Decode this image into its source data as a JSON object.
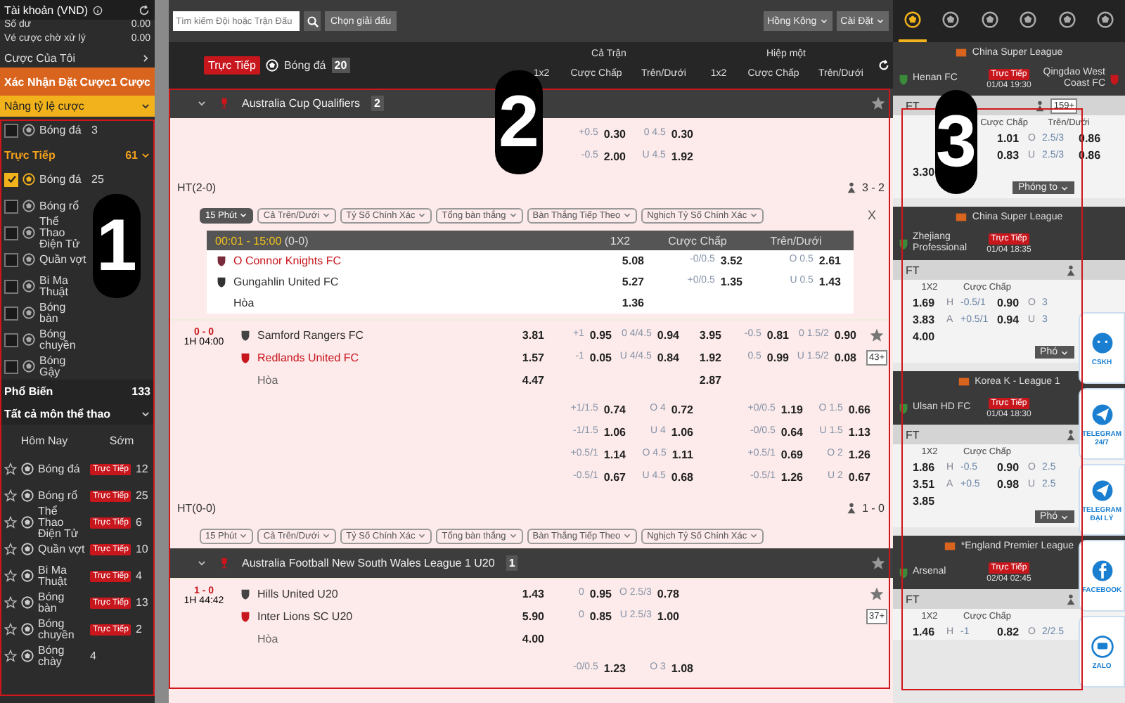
{
  "annotations": [
    "1",
    "2",
    "3"
  ],
  "sidebar": {
    "account": {
      "title": "Tài khoản (VND)",
      "rows": [
        {
          "label": "Số dư",
          "value": "0.00"
        },
        {
          "label": "Vé cược chờ xử lý",
          "value": "0.00"
        }
      ]
    },
    "my_bets": "Cược Của Tôi",
    "confirm": {
      "label": "Xác Nhận Đặt Cược",
      "count": "1 Cược"
    },
    "boost": {
      "label": "Nâng tỷ lệ cược",
      "items": [
        {
          "label": "Bóng đá",
          "count": "3",
          "checked": false
        }
      ]
    },
    "live": {
      "label": "Trực Tiếp",
      "count": "61",
      "items": [
        {
          "label": "Bóng đá",
          "count": "25",
          "checked": true
        },
        {
          "label": "Bóng rổ",
          "checked": false
        },
        {
          "label": "Thể Thao Điện Tử",
          "checked": false
        },
        {
          "label": "Quần vợt",
          "checked": false
        },
        {
          "label": "Bi Ma Thuật",
          "checked": false
        },
        {
          "label": "Bóng bàn",
          "checked": false
        },
        {
          "label": "Bóng chuyền",
          "checked": false
        },
        {
          "label": "Bóng Gậy",
          "checked": false
        }
      ]
    },
    "popular": {
      "label": "Phổ Biến",
      "count": "133"
    },
    "all_sports": {
      "label": "Tất cả môn thể thao",
      "columns": [
        "Hôm Nay",
        "Sớm"
      ],
      "items": [
        {
          "label": "Bóng đá",
          "badge": "Trực Tiếp",
          "count": "12"
        },
        {
          "label": "Bóng rổ",
          "badge": "Trực Tiếp",
          "count": "25"
        },
        {
          "label": "Thể Thao Điện Tử",
          "badge": "Trực Tiếp",
          "count": "6"
        },
        {
          "label": "Quần vợt",
          "badge": "Trực Tiếp",
          "count": "10"
        },
        {
          "label": "Bi Ma Thuật",
          "badge": "Trực Tiếp",
          "count": "4"
        },
        {
          "label": "Bóng bàn",
          "badge": "Trực Tiếp",
          "count": "13"
        },
        {
          "label": "Bóng chuyền",
          "badge": "Trực Tiếp",
          "count": "2"
        },
        {
          "label": "Bóng chày",
          "count": "4"
        }
      ]
    }
  },
  "main": {
    "search": {
      "placeholder": "Tìm kiếm Đội hoặc Trận Đấu"
    },
    "league_button": "Chọn giải đấu",
    "dropdowns": [
      "Hồng Kông",
      "Cài Đặt"
    ],
    "live_bar": {
      "badge": "Trực Tiếp",
      "sport": "Bóng đá",
      "count": "20"
    },
    "column_groups": [
      "Cả Trận",
      "Hiệp một"
    ],
    "columns": [
      "1x2",
      "Cược Chấp",
      "Trên/Dưới",
      "1x2",
      "Cược Chấp",
      "Trên/Dưới"
    ],
    "sections": [
      {
        "kind": "league",
        "name": "Australia Cup Qualifiers",
        "count": "2"
      },
      {
        "kind": "lines",
        "rows": [
          [
            null,
            {
              "line": "+0.5",
              "odds": "0.30"
            },
            {
              "line": "0 4.5",
              "odds": "0.30"
            },
            null,
            null,
            null
          ],
          [
            null,
            {
              "line": "-0.5",
              "odds": "2.00"
            },
            {
              "line": "U 4.5",
              "odds": "1.92"
            },
            null,
            null,
            null
          ]
        ]
      },
      {
        "kind": "ht",
        "label": "HT(2-0)",
        "score": "3 - 2"
      },
      {
        "kind": "chips",
        "close": "X",
        "chips": [
          {
            "label": "15 Phút",
            "selected": true
          },
          {
            "label": "Cả Trên/Dưới",
            "selected": false
          },
          {
            "label": "Tỷ Số Chính Xác",
            "selected": false
          },
          {
            "label": "Tổng bàn thắng",
            "selected": false
          },
          {
            "label": "Bàn Thắng Tiếp Theo",
            "selected": false
          },
          {
            "label": "Nghịch Tỷ Số Chính Xác",
            "selected": false
          }
        ]
      },
      {
        "kind": "detail",
        "period": "00:01 - 15:00",
        "score": "(0-0)",
        "columns": [
          "1X2",
          "Cược Chấp",
          "Trên/Dưới"
        ],
        "rows": [
          {
            "team": "O Connor Knights FC",
            "highlighted": true,
            "x12": "5.08",
            "hcap": {
              "line": "-0/0.5",
              "odds": "3.52"
            },
            "ou": {
              "line": "O 0.5",
              "odds": "2.61"
            }
          },
          {
            "team": "Gungahlin United FC",
            "highlighted": false,
            "x12": "5.27",
            "hcap": {
              "line": "+0/0.5",
              "odds": "1.35"
            },
            "ou": {
              "line": "U 0.5",
              "odds": "1.43"
            }
          },
          {
            "team": "Hòa",
            "x12": "1.36"
          }
        ]
      },
      {
        "kind": "match",
        "score": "0 - 0",
        "time": "1H 04:00",
        "teams": [
          {
            "name": "Samford Rangers FC",
            "highlighted": false
          },
          {
            "name": "Redlands United FC",
            "highlighted": true
          }
        ],
        "draw": "Hòa",
        "more": "43+",
        "rows": [
          [
            {
              "odds": "3.81"
            },
            {
              "line": "+1",
              "odds": "0.95"
            },
            {
              "line": "0 4/4.5",
              "odds": "0.94"
            },
            {
              "odds": "3.95"
            },
            {
              "line": "-0.5",
              "odds": "0.81"
            },
            {
              "line": "0 1.5/2",
              "odds": "0.90"
            }
          ],
          [
            {
              "odds": "1.57"
            },
            {
              "line": "-1",
              "odds": "0.05"
            },
            {
              "line": "U 4/4.5",
              "odds": "0.84"
            },
            {
              "odds": "1.92"
            },
            {
              "line": "0.5",
              "odds": "0.99"
            },
            {
              "line": "U 1.5/2",
              "odds": "0.08"
            }
          ],
          [
            {
              "odds": "4.47"
            },
            null,
            null,
            {
              "odds": "2.87"
            },
            null,
            null
          ]
        ]
      },
      {
        "kind": "lines",
        "rows": [
          [
            null,
            {
              "line": "+1/1.5",
              "odds": "0.74"
            },
            {
              "line": "O 4",
              "odds": "0.72"
            },
            null,
            {
              "line": "+0/0.5",
              "odds": "1.19"
            },
            {
              "line": "O 1.5",
              "odds": "0.66"
            }
          ],
          [
            null,
            {
              "line": "-1/1.5",
              "odds": "1.06"
            },
            {
              "line": "U 4",
              "odds": "1.06"
            },
            null,
            {
              "line": "-0/0.5",
              "odds": "0.64"
            },
            {
              "line": "U 1.5",
              "odds": "1.13"
            }
          ],
          [
            null,
            {
              "line": "+0.5/1",
              "odds": "1.14"
            },
            {
              "line": "O 4.5",
              "odds": "1.11"
            },
            null,
            {
              "line": "+0.5/1",
              "odds": "0.69"
            },
            {
              "line": "O 2",
              "odds": "1.26"
            }
          ],
          [
            null,
            {
              "line": "-0.5/1",
              "odds": "0.67"
            },
            {
              "line": "U 4.5",
              "odds": "0.68"
            },
            null,
            {
              "line": "-0.5/1",
              "odds": "1.26"
            },
            {
              "line": "U 2",
              "odds": "0.67"
            }
          ]
        ]
      },
      {
        "kind": "ht",
        "label": "HT(0-0)",
        "score": "1 - 0"
      },
      {
        "kind": "chips",
        "chips": [
          {
            "label": "15 Phút",
            "selected": false
          },
          {
            "label": "Cả Trên/Dưới",
            "selected": false
          },
          {
            "label": "Tỷ Số Chính Xác",
            "selected": false
          },
          {
            "label": "Tổng bàn thắng",
            "selected": false
          },
          {
            "label": "Bàn Thắng Tiếp Theo",
            "selected": false
          },
          {
            "label": "Nghịch Tỷ Số Chính Xác",
            "selected": false
          }
        ]
      },
      {
        "kind": "league",
        "name": "Australia Football New South Wales League 1 U20",
        "count": "1"
      },
      {
        "kind": "match",
        "score": "1 - 0",
        "time": "1H 44:42",
        "teams": [
          {
            "name": "Hills United U20",
            "highlighted": false
          },
          {
            "name": "Inter Lions SC U20",
            "highlighted": false
          }
        ],
        "draw": "Hòa",
        "more": "37+",
        "rows": [
          [
            {
              "odds": "1.43"
            },
            {
              "line": "0",
              "odds": "0.95"
            },
            {
              "line": "O 2.5/3",
              "odds": "0.78"
            },
            null,
            null,
            null
          ],
          [
            {
              "odds": "5.90"
            },
            {
              "line": "0",
              "odds": "0.85"
            },
            {
              "line": "U 2.5/3",
              "odds": "1.00"
            },
            null,
            null,
            null
          ],
          [
            {
              "odds": "4.00"
            },
            null,
            null,
            null,
            null,
            null
          ]
        ]
      },
      {
        "kind": "lines",
        "rows": [
          [
            null,
            {
              "line": "-0/0.5",
              "odds": "1.23"
            },
            {
              "line": "O 3",
              "odds": "1.08"
            },
            null,
            null,
            null
          ]
        ]
      }
    ]
  },
  "right_panel": {
    "sport_tabs": [
      {
        "selected": true
      },
      {
        "selected": false
      },
      {
        "selected": false
      },
      {
        "selected": false
      },
      {
        "selected": false
      },
      {
        "selected": false
      }
    ],
    "cards": [
      {
        "league": "China Super League",
        "home": "Henan FC",
        "live": "Trực Tiếp",
        "time": "01/04 19:30",
        "away": "Qingdao West Coast FC",
        "status": "FT",
        "more": "159+",
        "headers": {
          "hcap": "Cược Chấp",
          "ou": "Trên/Dưới"
        },
        "rows": [
          {
            "hcap": {
              "odds": "1.01"
            },
            "ou": {
              "side": "O",
              "line": "2.5/3",
              "odds": "0.86"
            }
          },
          {
            "hcap": {
              "odds": "0.83"
            },
            "ou": {
              "side": "U",
              "line": "2.5/3",
              "odds": "0.86"
            }
          },
          {
            "x12": "3.30"
          }
        ],
        "expand": "Phóng to"
      },
      {
        "league": "China Super League",
        "home": "Zhejiang Professional",
        "live": "Trực Tiếp",
        "time": "01/04 18:35",
        "status": "FT",
        "headers": {
          "x12": "1X2",
          "hcap": "Cược Chấp"
        },
        "rows": [
          {
            "x12": "1.69",
            "hcap": {
              "side": "H",
              "line": "-0.5/1",
              "odds": "0.90"
            },
            "ou": {
              "side": "O",
              "line": "3"
            }
          },
          {
            "x12": "3.83",
            "hcap": {
              "side": "A",
              "line": "+0.5/1",
              "odds": "0.94"
            },
            "ou": {
              "side": "U",
              "line": "3"
            }
          },
          {
            "x12": "4.00"
          }
        ],
        "expand": "Phó"
      },
      {
        "league": "Korea K - League 1",
        "home": "Ulsan HD FC",
        "live": "Trực Tiếp",
        "time": "01/04 18:30",
        "status": "FT",
        "headers": {
          "x12": "1X2",
          "hcap": "Cược Chấp"
        },
        "rows": [
          {
            "x12": "1.86",
            "hcap": {
              "side": "H",
              "line": "-0.5",
              "odds": "0.90"
            },
            "ou": {
              "side": "O",
              "line": "2.5"
            }
          },
          {
            "x12": "3.51",
            "hcap": {
              "side": "A",
              "line": "+0.5",
              "odds": "0.98"
            },
            "ou": {
              "side": "U",
              "line": "2.5"
            }
          },
          {
            "x12": "3.85"
          }
        ],
        "expand": "Phó"
      },
      {
        "league": "*England Premier League",
        "home": "Arsenal",
        "live": "Trực Tiếp",
        "time": "02/04 02:45",
        "status": "FT",
        "headers": {
          "x12": "1X2",
          "hcap": "Cược Chấp"
        },
        "rows": [
          {
            "x12": "1.46",
            "hcap": {
              "side": "H",
              "line": "-1",
              "odds": "0.82"
            },
            "ou": {
              "side": "O",
              "line": "2/2.5"
            }
          }
        ]
      }
    ],
    "contacts": [
      {
        "label": "CSKH"
      },
      {
        "label": "TELEGRAM 24/7"
      },
      {
        "label": "TELEGRAM ĐẠI LÝ"
      },
      {
        "label": "FACEBOOK"
      },
      {
        "label": "ZALO"
      }
    ]
  }
}
